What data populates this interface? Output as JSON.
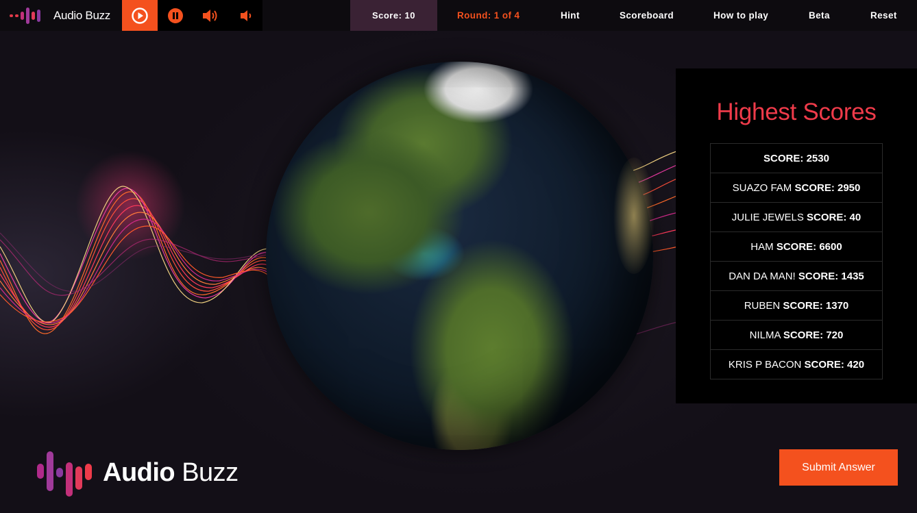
{
  "app": {
    "brand_name": "Audio Buzz"
  },
  "controls": {
    "play_icon": "play-circle-icon",
    "pause_icon": "pause-circle-icon",
    "volume_up_icon": "volume-up-icon",
    "volume_down_icon": "volume-down-icon"
  },
  "nav": {
    "score": "Score: 10",
    "round": "Round: 1 of 4",
    "hint": "Hint",
    "scoreboard": "Scoreboard",
    "how_to_play": "How to play",
    "beta": "Beta",
    "reset": "Reset"
  },
  "scores": {
    "title": "Highest Scores",
    "score_label": "SCORE:",
    "rows": [
      {
        "name": "",
        "score": "2530"
      },
      {
        "name": "SUAZO FAM",
        "score": "2950"
      },
      {
        "name": "JULIE JEWELS",
        "score": "40"
      },
      {
        "name": "HAM",
        "score": "6600"
      },
      {
        "name": "DAN DA MAN!",
        "score": "1435"
      },
      {
        "name": "RUBEN",
        "score": "1370"
      },
      {
        "name": "NILMA",
        "score": "720"
      },
      {
        "name": "KRIS P BACON",
        "score": "420"
      }
    ]
  },
  "footer": {
    "logo_bold": "Audio",
    "logo_light": " Buzz",
    "submit_label": "Submit Answer"
  },
  "colors": {
    "accent": "#f4511e",
    "title_red": "#ef3b4a",
    "score_box": "#3a2234",
    "background": "#130f17"
  }
}
